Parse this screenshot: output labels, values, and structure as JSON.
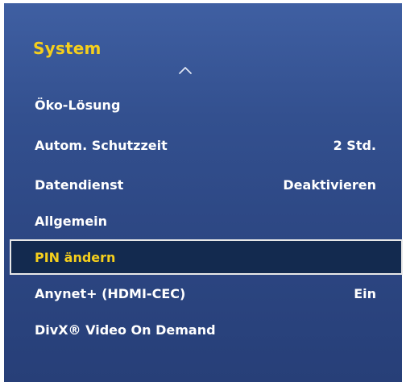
{
  "menu": {
    "title": "System",
    "scroll_up_icon": "chevron-up-icon",
    "items": [
      {
        "label": "Öko-Lösung",
        "value": ""
      },
      {
        "label": "Autom. Schutzzeit",
        "value": "2 Std."
      },
      {
        "label": "Datendienst",
        "value": "Deaktivieren"
      },
      {
        "label": "Allgemein",
        "value": ""
      },
      {
        "label": "PIN ändern",
        "value": "",
        "selected": true
      },
      {
        "label": "Anynet+ (HDMI-CEC)",
        "value": "Ein"
      },
      {
        "label": "DivX® Video On Demand",
        "value": ""
      }
    ]
  },
  "colors": {
    "panel_background": "#2f4a88",
    "title_yellow": "#f5cf1c",
    "selected_background": "#132a4f",
    "selected_border": "#e8e8e8",
    "text": "#ffffff"
  }
}
